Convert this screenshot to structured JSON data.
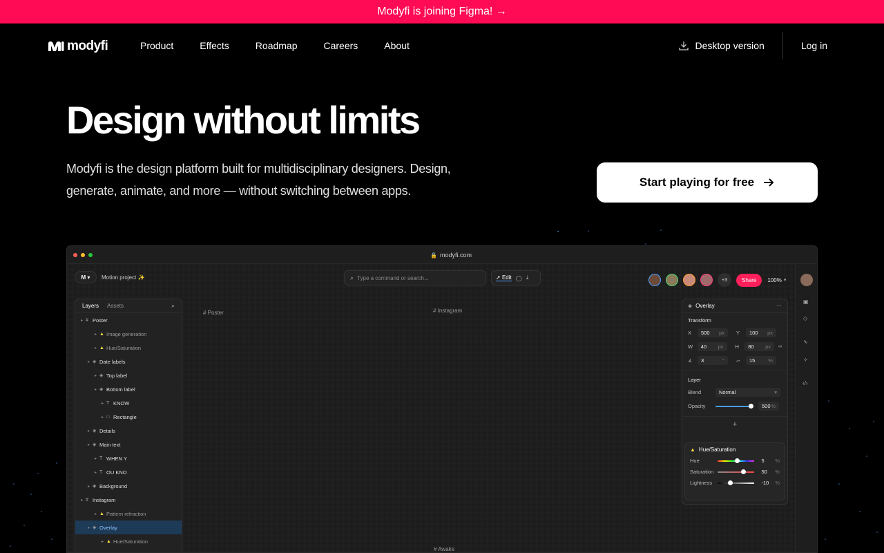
{
  "announcement": {
    "text": "Modyfi is joining Figma! →"
  },
  "nav": {
    "brand": "modyfi",
    "links": [
      "Product",
      "Effects",
      "Roadmap",
      "Careers",
      "About"
    ],
    "desktop_label": "Desktop version",
    "login_label": "Log in"
  },
  "hero": {
    "title": "Design without limits",
    "subtitle": "Modyfi is the design platform built for multidisciplinary designers. Design, generate, animate, and more — without switching between apps.",
    "cta_label": "Start playing for free"
  },
  "mockup": {
    "url": "modyfi.com",
    "project_name": "Motion project ✨",
    "command_placeholder": "Type a command or search...",
    "edit_label": "Edit",
    "extra_collaborators": "+3",
    "share_label": "Share",
    "zoom": "100%",
    "layers_tab": "Layers",
    "assets_tab": "Assets",
    "layers": [
      {
        "label": "Poster",
        "icon": "#",
        "indent": 0
      },
      {
        "label": "Image generation",
        "icon": "▲",
        "indent": 2,
        "dim": true
      },
      {
        "label": "Hue/Saturation",
        "icon": "▲",
        "indent": 2,
        "dim": true
      },
      {
        "label": "Date labels",
        "icon": "◈",
        "indent": 1
      },
      {
        "label": "Top label",
        "icon": "◈",
        "indent": 2
      },
      {
        "label": "Bottom label",
        "icon": "◈",
        "indent": 2
      },
      {
        "label": "KNOW",
        "icon": "T",
        "indent": 3
      },
      {
        "label": "Rectangle",
        "icon": "□",
        "indent": 3
      },
      {
        "label": "Details",
        "icon": "◈",
        "indent": 1
      },
      {
        "label": "Main text",
        "icon": "◈",
        "indent": 1
      },
      {
        "label": "WHEN Y",
        "icon": "T",
        "indent": 2
      },
      {
        "label": "OU KNO",
        "icon": "T",
        "indent": 2
      },
      {
        "label": "Background",
        "icon": "◈",
        "indent": 1
      },
      {
        "label": "Instagram",
        "icon": "#",
        "indent": 0
      },
      {
        "label": "Pattern refraction",
        "icon": "▲",
        "indent": 2,
        "dim": true
      },
      {
        "label": "Overlay",
        "icon": "◈",
        "indent": 1,
        "selected": true
      },
      {
        "label": "Hue/Saturation",
        "icon": "▲",
        "indent": 3,
        "dim": true
      }
    ],
    "canvas_labels": {
      "poster": "Poster",
      "instagram": "Instagram",
      "awake": "Awake"
    },
    "props": {
      "title": "Overlay",
      "transform_label": "Transform",
      "x": "500",
      "y": "100",
      "w": "40",
      "h": "80",
      "rotation": "3",
      "skew": "15",
      "unit_px": "px",
      "unit_deg": "°",
      "unit_pct": "%",
      "layer_label": "Layer",
      "blend_label": "Blend",
      "blend_value": "Normal",
      "opacity_label": "Opacity",
      "opacity_value": "500",
      "effect_title": "Hue/Saturation",
      "hue_label": "Hue",
      "hue_value": "5",
      "saturation_label": "Saturation",
      "saturation_value": "50",
      "lightness_label": "Lightness",
      "lightness_value": "-10",
      "x_label": "X",
      "y_label": "Y",
      "w_label": "W",
      "h_label": "H"
    }
  },
  "colors": {
    "announce_bg": "#ff0a54",
    "share_bg": "#ff1f5a",
    "selected_bg": "#1d3a57"
  }
}
